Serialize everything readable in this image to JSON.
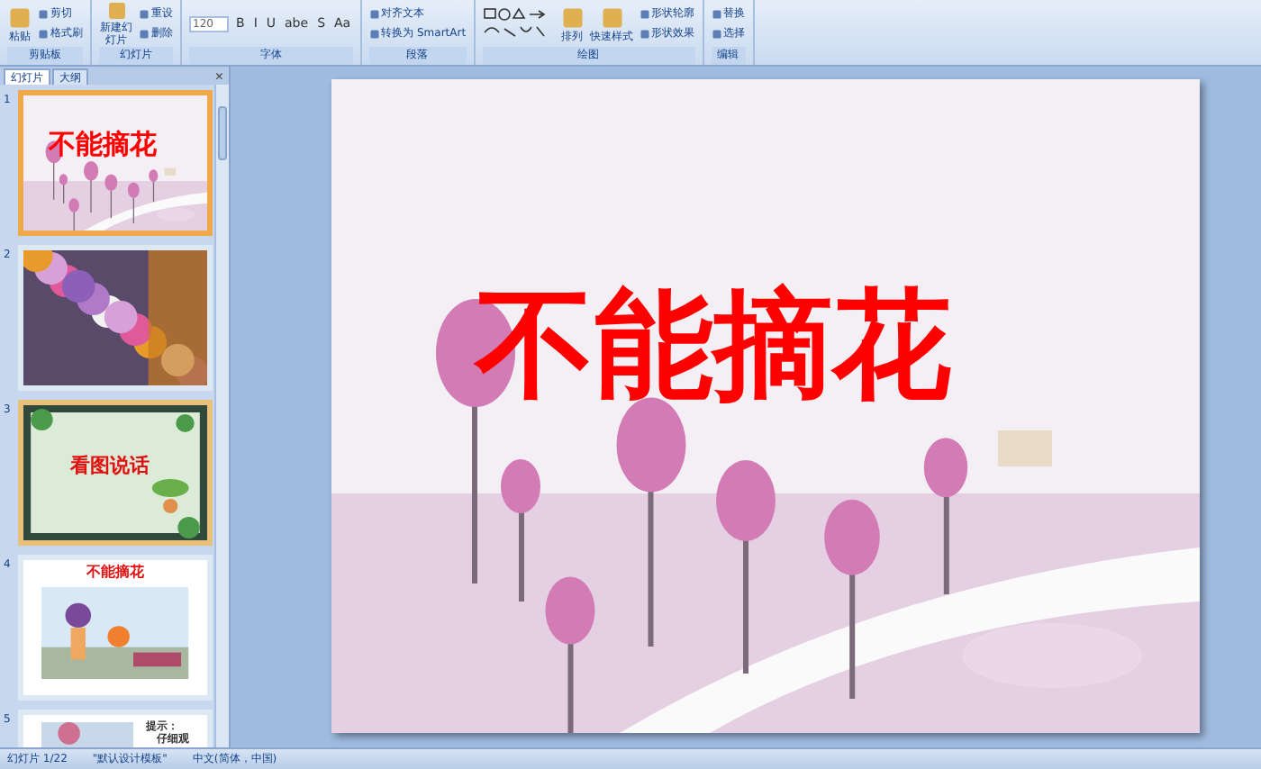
{
  "ribbon": {
    "groups": [
      {
        "label": "剪贴板",
        "items": [
          {
            "kind": "big",
            "label": "粘贴"
          },
          {
            "kind": "small",
            "label": "剪切"
          },
          {
            "kind": "small",
            "label": "格式刷"
          }
        ]
      },
      {
        "label": "幻灯片",
        "items": [
          {
            "kind": "tall",
            "label": "新建幻灯片"
          },
          {
            "kind": "small",
            "label": "重设"
          },
          {
            "kind": "small",
            "label": "删除"
          }
        ]
      },
      {
        "label": "字体",
        "items": [
          {
            "kind": "field",
            "label": "120"
          },
          {
            "kind": "format",
            "label": "B"
          },
          {
            "kind": "format",
            "label": "I"
          },
          {
            "kind": "format",
            "label": "U"
          },
          {
            "kind": "format",
            "label": "abe"
          },
          {
            "kind": "format",
            "label": "S"
          },
          {
            "kind": "format",
            "label": "Aa"
          }
        ]
      },
      {
        "label": "段落",
        "items": [
          {
            "kind": "small",
            "label": "对齐文本"
          },
          {
            "kind": "small",
            "label": "转换为 SmartArt"
          }
        ]
      },
      {
        "label": "绘图",
        "items": [
          {
            "kind": "shapes"
          },
          {
            "kind": "big",
            "label": "排列"
          },
          {
            "kind": "big",
            "label": "快速样式"
          },
          {
            "kind": "small",
            "label": "形状轮廓"
          },
          {
            "kind": "small",
            "label": "形状效果"
          }
        ]
      },
      {
        "label": "编辑",
        "items": [
          {
            "kind": "small",
            "label": "替换"
          },
          {
            "kind": "small",
            "label": "选择"
          }
        ]
      }
    ]
  },
  "panel": {
    "tabs": [
      {
        "label": "幻灯片",
        "selected": true
      },
      {
        "label": "大纲",
        "selected": false
      }
    ],
    "close": "×",
    "slides": [
      {
        "number": "1",
        "selected": true,
        "hovered": false,
        "kind": "title",
        "texts": [
          "不能摘花"
        ]
      },
      {
        "number": "2",
        "selected": false,
        "hovered": false,
        "kind": "flowers"
      },
      {
        "number": "3",
        "selected": false,
        "hovered": true,
        "kind": "green",
        "texts": [
          "看图说话"
        ]
      },
      {
        "number": "4",
        "selected": false,
        "hovered": false,
        "kind": "cartoon",
        "texts": [
          "不能摘花"
        ]
      },
      {
        "number": "5",
        "selected": false,
        "hovered": false,
        "kind": "note",
        "texts": [
          "提示：",
          "仔细观"
        ]
      }
    ]
  },
  "slide": {
    "title": "不能摘花"
  },
  "status_bar": [
    "幻灯片 1/22",
    "\"默认设计模板\"",
    "中文(简体，中国)"
  ]
}
